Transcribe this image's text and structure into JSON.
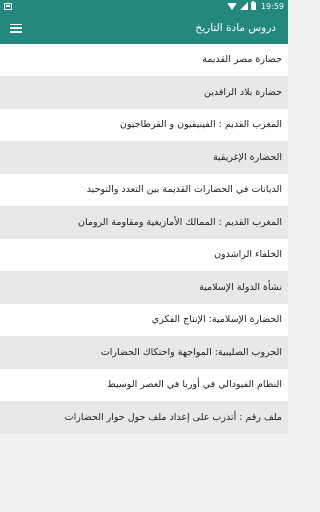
{
  "status_bar": {
    "time": "19:59",
    "icons": [
      "notification-icon",
      "wifi-icon",
      "signal-icon",
      "battery-icon"
    ]
  },
  "toolbar": {
    "title": "دروس مادة التاريخ",
    "menu_icon": "hamburger-menu-icon"
  },
  "colors": {
    "primary": "#23887e",
    "row_alt": "#e8e8e8",
    "text": "#222222"
  },
  "lessons": [
    "حضارة مصر القديمة",
    "حضارة بلاد الرافدين",
    "المغرب القديم : الفينيقيون و القرطاجيون",
    "الحضارة الإغريقية",
    "الديانات في الحضارات القديمة بين التعدد والتوحيد",
    "المغرب القديم : الممالك الأمازيغية ومقاومة الرومان",
    "الخلفاء الراشدون",
    "نشأة الدولة الإسلامية",
    "الحضارة الإسلامية: الإنتاج الفكري",
    "الحروب الصليبية: المواجهة واحتكاك الحضارات",
    "النظام الفيودالي في أوربا في العصر الوسيط",
    "ملف رقم : أتدرب على إعداد ملف حول حوار الحضارات"
  ]
}
